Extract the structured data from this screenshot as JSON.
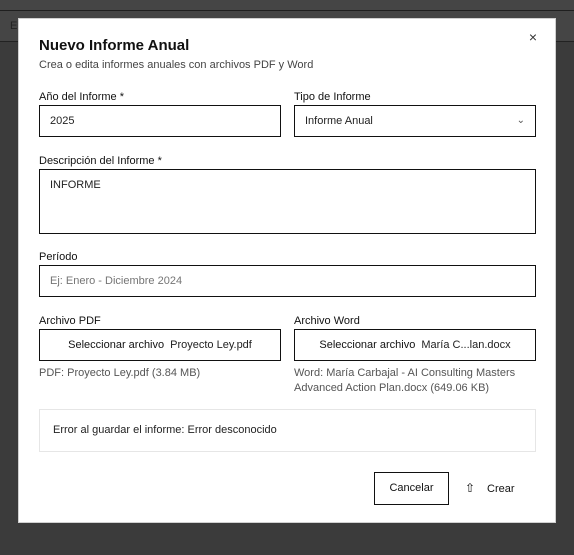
{
  "backdrop": {
    "letter": "E"
  },
  "dialog": {
    "title": "Nuevo Informe Anual",
    "subtitle": "Crea o edita informes anuales con archivos PDF y Word",
    "close_icon": "close-icon",
    "close_glyph": "×"
  },
  "form": {
    "year": {
      "label": "Año del Informe *",
      "value": "2025"
    },
    "type": {
      "label": "Tipo de Informe",
      "value": "Informe Anual",
      "chevron": "⌄"
    },
    "description": {
      "label": "Descripción del Informe *",
      "value": "INFORME"
    },
    "period": {
      "label": "Período",
      "placeholder": "Ej: Enero - Diciembre 2024"
    },
    "pdf": {
      "label": "Archivo PDF",
      "button": "Seleccionar archivo",
      "filename": "Proyecto Ley.pdf",
      "info": "PDF: Proyecto Ley.pdf (3.84 MB)"
    },
    "word": {
      "label": "Archivo Word",
      "button": "Seleccionar archivo",
      "filename": "María C...lan.docx",
      "info": "Word: María Carbajal - AI Consulting Masters Advanced Action Plan.docx (649.06 KB)"
    }
  },
  "error": {
    "message": "Error al guardar el informe: Error desconocido"
  },
  "actions": {
    "cancel": "Cancelar",
    "create": "Crear",
    "create_icon": "upload-icon",
    "create_glyph": "⇧"
  }
}
